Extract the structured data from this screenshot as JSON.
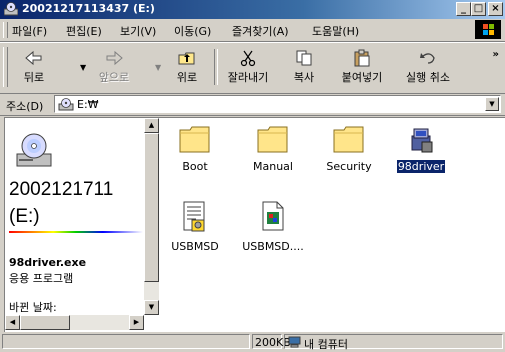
{
  "window": {
    "title": "20021217113437 (E:)",
    "min_glyph": "_",
    "max_glyph": "□",
    "close_glyph": "×"
  },
  "menu": {
    "items": [
      "파일(F)",
      "편집(E)",
      "보기(V)",
      "이동(G)",
      "즐겨찾기(A)",
      "도움말(H)"
    ]
  },
  "toolbar": {
    "back": "뒤로",
    "forward": "앞으로",
    "up": "위로",
    "cut": "잘라내기",
    "copy": "복사",
    "paste": "붙여넣기",
    "undo": "실행 취소",
    "more": "»"
  },
  "address": {
    "label": "주소(D)",
    "value": "E:₩"
  },
  "info_pane": {
    "drive_title": "2002121711",
    "drive_letter": "(E:)",
    "selected_name": "98driver.exe",
    "selected_type": "응용 프로그램",
    "modified_label": "바뀐 날짜:"
  },
  "files": [
    {
      "name": "Boot",
      "icon": "folder-icon",
      "selected": false
    },
    {
      "name": "Manual",
      "icon": "folder-icon",
      "selected": false
    },
    {
      "name": "Security",
      "icon": "folder-icon",
      "selected": false
    },
    {
      "name": "98driver",
      "icon": "setup-program-icon",
      "selected": true
    },
    {
      "name": "USBMSD",
      "icon": "setup-info-file-icon",
      "selected": false
    },
    {
      "name": "USBMSD....",
      "icon": "installer-file-icon",
      "selected": false
    }
  ],
  "status": {
    "size": "200KB",
    "zone": "내 컴퓨터"
  },
  "colors": {
    "titlebar": "#0a246a",
    "selection": "#0a246a",
    "chrome": "#d4d0c8"
  }
}
